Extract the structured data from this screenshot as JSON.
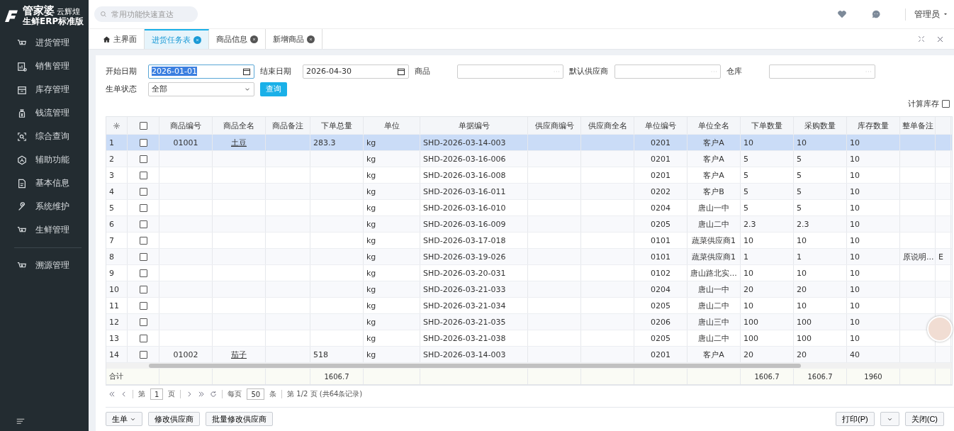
{
  "logo": {
    "brand": "管家婆",
    "edition": "云辉煌",
    "product": "生鲜ERP标准版"
  },
  "sidebar": {
    "items": [
      {
        "label": "进货管理"
      },
      {
        "label": "销售管理"
      },
      {
        "label": "库存管理"
      },
      {
        "label": "钱流管理"
      },
      {
        "label": "综合查询"
      },
      {
        "label": "辅助功能"
      },
      {
        "label": "基本信息"
      },
      {
        "label": "系统维护"
      },
      {
        "label": "生鲜管理"
      }
    ],
    "extra_items": [
      {
        "label": "溯源管理"
      }
    ]
  },
  "header": {
    "search": {
      "placeholder": "常用功能快速直达"
    },
    "user": "管理员"
  },
  "tabs": [
    {
      "label": "主界面",
      "selected": false,
      "closable": false
    },
    {
      "label": "进货任务表",
      "selected": true,
      "closable": true
    },
    {
      "label": "商品信息",
      "selected": false,
      "closable": true
    },
    {
      "label": "新增商品",
      "selected": false,
      "closable": true
    }
  ],
  "filters": {
    "start_date": {
      "label": "开始日期",
      "value": "2026-01-01"
    },
    "end_date": {
      "label": "结束日期",
      "value": "2026-04-30"
    },
    "product": {
      "label": "商品"
    },
    "supplier": {
      "label": "默认供应商"
    },
    "warehouse": {
      "label": "仓库"
    },
    "status": {
      "label": "生单状态",
      "value": "全部"
    },
    "query_button": "查询",
    "calc_stock": {
      "label": "计算库存",
      "checked": false
    }
  },
  "table": {
    "header_checked": false,
    "columns": [
      "商品编号",
      "商品全名",
      "商品备注",
      "下单总量",
      "单位",
      "单据编号",
      "供应商编号",
      "供应商全名",
      "单位编号",
      "单位全名",
      "下单数量",
      "采购数量",
      "库存数量",
      "整单备注"
    ],
    "rows": [
      {
        "no": "1",
        "selected": true,
        "checked": false,
        "cells": [
          "01001",
          "土豆",
          "",
          "283.3",
          "kg",
          "SHD-2026-03-14-003",
          "",
          "",
          "0201",
          "客户A",
          "10",
          "10",
          "10",
          "",
          ""
        ]
      },
      {
        "no": "2",
        "selected": false,
        "checked": false,
        "cells": [
          "",
          "",
          "",
          "",
          "kg",
          "SHD-2026-03-16-006",
          "",
          "",
          "0201",
          "客户A",
          "5",
          "5",
          "10",
          "",
          ""
        ]
      },
      {
        "no": "3",
        "selected": false,
        "checked": false,
        "cells": [
          "",
          "",
          "",
          "",
          "kg",
          "SHD-2026-03-16-008",
          "",
          "",
          "0201",
          "客户A",
          "5",
          "5",
          "10",
          "",
          ""
        ]
      },
      {
        "no": "4",
        "selected": false,
        "checked": false,
        "cells": [
          "",
          "",
          "",
          "",
          "kg",
          "SHD-2026-03-16-011",
          "",
          "",
          "0202",
          "客户B",
          "5",
          "5",
          "10",
          "",
          ""
        ]
      },
      {
        "no": "5",
        "selected": false,
        "checked": false,
        "cells": [
          "",
          "",
          "",
          "",
          "kg",
          "SHD-2026-03-16-010",
          "",
          "",
          "0204",
          "唐山一中",
          "5",
          "5",
          "10",
          "",
          ""
        ]
      },
      {
        "no": "6",
        "selected": false,
        "checked": false,
        "cells": [
          "",
          "",
          "",
          "",
          "kg",
          "SHD-2026-03-16-009",
          "",
          "",
          "0205",
          "唐山二中",
          "2.3",
          "2.3",
          "10",
          "",
          ""
        ]
      },
      {
        "no": "7",
        "selected": false,
        "checked": false,
        "cells": [
          "",
          "",
          "",
          "",
          "kg",
          "SHD-2026-03-17-018",
          "",
          "",
          "0101",
          "蔬菜供应商1",
          "10",
          "10",
          "10",
          "",
          ""
        ]
      },
      {
        "no": "8",
        "selected": false,
        "checked": false,
        "cells": [
          "",
          "",
          "",
          "",
          "kg",
          "SHD-2026-03-19-026",
          "",
          "",
          "0101",
          "蔬菜供应商1",
          "1",
          "1",
          "10",
          "原说明...",
          "E"
        ]
      },
      {
        "no": "9",
        "selected": false,
        "checked": false,
        "cells": [
          "",
          "",
          "",
          "",
          "kg",
          "SHD-2026-03-20-031",
          "",
          "",
          "0102",
          "唐山路北实...",
          "10",
          "10",
          "10",
          "",
          ""
        ]
      },
      {
        "no": "10",
        "selected": false,
        "checked": false,
        "cells": [
          "",
          "",
          "",
          "",
          "kg",
          "SHD-2026-03-21-033",
          "",
          "",
          "0204",
          "唐山一中",
          "20",
          "20",
          "10",
          "",
          ""
        ]
      },
      {
        "no": "11",
        "selected": false,
        "checked": false,
        "cells": [
          "",
          "",
          "",
          "",
          "kg",
          "SHD-2026-03-21-034",
          "",
          "",
          "0205",
          "唐山二中",
          "10",
          "10",
          "10",
          "",
          ""
        ]
      },
      {
        "no": "12",
        "selected": false,
        "checked": false,
        "cells": [
          "",
          "",
          "",
          "",
          "kg",
          "SHD-2026-03-21-035",
          "",
          "",
          "0206",
          "唐山三中",
          "100",
          "100",
          "10",
          "",
          ""
        ]
      },
      {
        "no": "13",
        "selected": false,
        "checked": false,
        "cells": [
          "",
          "",
          "",
          "",
          "kg",
          "SHD-2026-03-21-038",
          "",
          "",
          "0205",
          "唐山二中",
          "100",
          "100",
          "10",
          "",
          ""
        ]
      },
      {
        "no": "14",
        "selected": false,
        "checked": false,
        "cells": [
          "01002",
          "茄子",
          "",
          "518",
          "kg",
          "SHD-2026-03-14-003",
          "",
          "",
          "0201",
          "客户A",
          "20",
          "20",
          "40",
          "",
          ""
        ]
      }
    ],
    "totals": {
      "label": "合计",
      "cells": [
        "",
        "",
        "",
        "1606.7",
        "",
        "",
        "",
        "",
        "",
        "",
        "1606.7",
        "1606.7",
        "1960",
        "",
        ""
      ]
    }
  },
  "pager": {
    "page_prefix": "第",
    "page": "1",
    "page_suffix": "页",
    "per_page_prefix": "每页",
    "per_page": "50",
    "per_page_suffix": "条",
    "summary": "第 1/2 页 (共64条记录)"
  },
  "footer_buttons": {
    "left": [
      "生单",
      "修改供应商",
      "批量修改供应商"
    ],
    "right": [
      "打印(P)",
      "关闭(C)"
    ]
  }
}
